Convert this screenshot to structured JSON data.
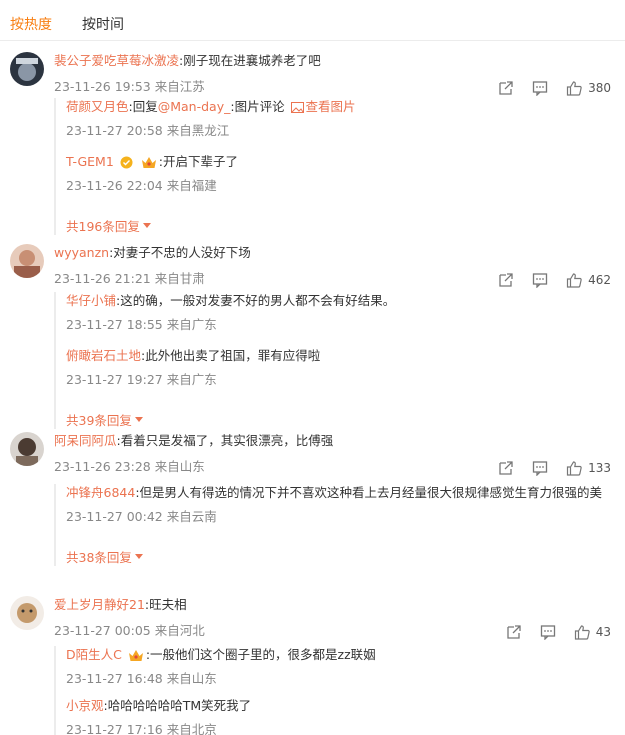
{
  "tabs": [
    "按热度",
    "按时间"
  ],
  "comments": [
    {
      "user": "裴公子爱吃草莓冰激凌",
      "text": ":刚子现在进襄城养老了吧",
      "meta": "23-11-26 19:53 来自江苏",
      "likes": "380",
      "replies": [
        {
          "user": "荷颜又月色",
          "text_pre": ":回复",
          "mention": "@Man-day_",
          "text_post": ":图片评论 ",
          "link": "查看图片",
          "meta": "23-11-27 20:58 来自黑龙江"
        },
        {
          "user": "T-GEM1",
          "text": ":开启下辈子了",
          "meta": "23-11-26 22:04 来自福建"
        }
      ],
      "more": "共196条回复"
    },
    {
      "user": "wyyanzn",
      "text": ":对妻子不忠的人没好下场",
      "meta": "23-11-26 21:21 来自甘肃",
      "likes": "462",
      "replies": [
        {
          "user": "华仔小铺",
          "text": ":这的确，一般对发妻不好的男人都不会有好结果。",
          "meta": "23-11-27 18:55 来自广东"
        },
        {
          "user": "俯瞰岩石土地",
          "text": ":此外他出卖了祖国，罪有应得啦",
          "meta": "23-11-27 19:27 来自广东"
        }
      ],
      "more": "共39条回复"
    },
    {
      "user": "阿呆同阿瓜",
      "text": ":看着只是发福了，其实很漂亮，比傅强",
      "meta": "23-11-26 23:28 来自山东",
      "likes": "133",
      "replies": [
        {
          "user": "冲锋舟6844",
          "text": ":但是男人有得选的情况下并不喜欢这种看上去月经量很大很规律感觉生育力很强的美",
          "meta": "23-11-27 00:42 来自云南"
        }
      ],
      "more": "共38条回复"
    },
    {
      "user": "爱上岁月静好21",
      "text": ":旺夫相",
      "meta": "23-11-27 00:05 来自河北",
      "likes": "43",
      "replies": [
        {
          "user": "D陌生人C",
          "text": ":一般他们这个圈子里的，很多都是zz联姻",
          "meta": "23-11-27 16:48 来自山东"
        },
        {
          "user": "小京观",
          "text": ":哈哈哈哈哈哈TM笑死我了",
          "meta": "23-11-27 17:16 来自北京"
        }
      ]
    }
  ],
  "colors": {
    "accent": "#f87f13",
    "username": "#eb7350",
    "meta": "#888888"
  },
  "icons": [
    "share-icon",
    "comment-icon",
    "like-icon",
    "verified-icon",
    "crown-badge-icon",
    "image-icon"
  ]
}
